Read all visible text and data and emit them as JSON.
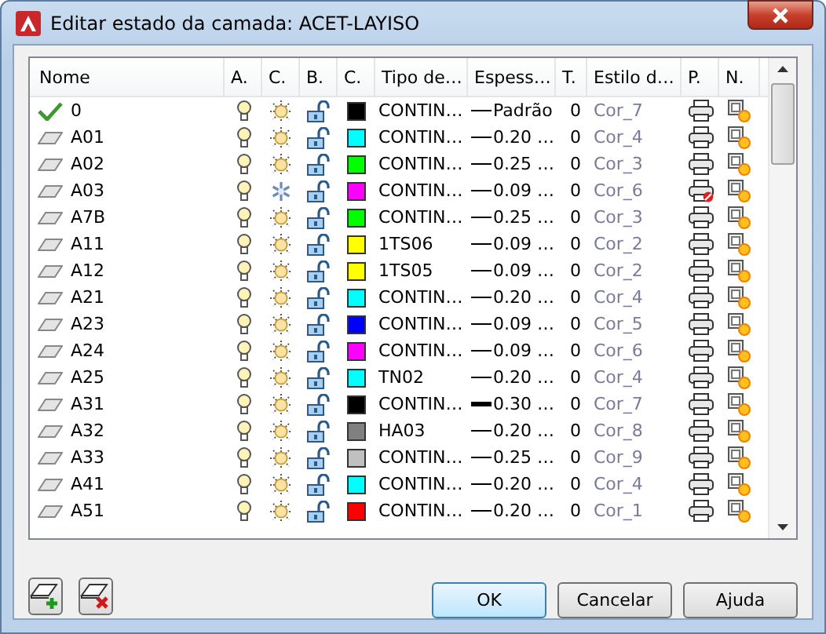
{
  "window": {
    "title": "Editar estado da camada: ACET-LAYISO"
  },
  "columns": [
    "Nome",
    "A.",
    "C.",
    "B.",
    "C.",
    "Tipo de…",
    "Espess…",
    "T.",
    "Estilo d…",
    "P.",
    "N."
  ],
  "rows": [
    {
      "name": "0",
      "current": true,
      "on": true,
      "frozen": false,
      "locked": false,
      "color": "#000000",
      "linetype": "CONTIN…",
      "lineweight": "Padrão",
      "heavy": false,
      "transparency": "0",
      "plot_style": "Cor_7",
      "plot": true
    },
    {
      "name": "A01",
      "current": false,
      "on": true,
      "frozen": false,
      "locked": false,
      "color": "#00ffff",
      "linetype": "CONTIN…",
      "lineweight": "0.20 …",
      "heavy": false,
      "transparency": "0",
      "plot_style": "Cor_4",
      "plot": true
    },
    {
      "name": "A02",
      "current": false,
      "on": true,
      "frozen": false,
      "locked": false,
      "color": "#00ff00",
      "linetype": "CONTIN…",
      "lineweight": "0.25 …",
      "heavy": false,
      "transparency": "0",
      "plot_style": "Cor_3",
      "plot": true
    },
    {
      "name": "A03",
      "current": false,
      "on": true,
      "frozen": true,
      "locked": false,
      "color": "#ff00ff",
      "linetype": "CONTIN…",
      "lineweight": "0.09 …",
      "heavy": false,
      "transparency": "0",
      "plot_style": "Cor_6",
      "plot": false
    },
    {
      "name": "A7B",
      "current": false,
      "on": true,
      "frozen": false,
      "locked": false,
      "color": "#00ff00",
      "linetype": "CONTIN…",
      "lineweight": "0.25 …",
      "heavy": false,
      "transparency": "0",
      "plot_style": "Cor_3",
      "plot": true
    },
    {
      "name": "A11",
      "current": false,
      "on": true,
      "frozen": false,
      "locked": false,
      "color": "#ffff00",
      "linetype": "1TS06",
      "lineweight": "0.09 …",
      "heavy": false,
      "transparency": "0",
      "plot_style": "Cor_2",
      "plot": true
    },
    {
      "name": "A12",
      "current": false,
      "on": true,
      "frozen": false,
      "locked": false,
      "color": "#ffff00",
      "linetype": "1TS05",
      "lineweight": "0.09 …",
      "heavy": false,
      "transparency": "0",
      "plot_style": "Cor_2",
      "plot": true
    },
    {
      "name": "A21",
      "current": false,
      "on": true,
      "frozen": false,
      "locked": false,
      "color": "#00ffff",
      "linetype": "CONTIN…",
      "lineweight": "0.20 …",
      "heavy": false,
      "transparency": "0",
      "plot_style": "Cor_4",
      "plot": true
    },
    {
      "name": "A23",
      "current": false,
      "on": true,
      "frozen": false,
      "locked": false,
      "color": "#0000ff",
      "linetype": "CONTIN…",
      "lineweight": "0.09 …",
      "heavy": false,
      "transparency": "0",
      "plot_style": "Cor_5",
      "plot": true
    },
    {
      "name": "A24",
      "current": false,
      "on": true,
      "frozen": false,
      "locked": false,
      "color": "#ff00ff",
      "linetype": "CONTIN…",
      "lineweight": "0.09 …",
      "heavy": false,
      "transparency": "0",
      "plot_style": "Cor_6",
      "plot": true
    },
    {
      "name": "A25",
      "current": false,
      "on": true,
      "frozen": false,
      "locked": false,
      "color": "#00ffff",
      "linetype": "TN02",
      "lineweight": "0.20 …",
      "heavy": false,
      "transparency": "0",
      "plot_style": "Cor_4",
      "plot": true
    },
    {
      "name": "A31",
      "current": false,
      "on": true,
      "frozen": false,
      "locked": false,
      "color": "#000000",
      "linetype": "CONTIN…",
      "lineweight": "0.30 …",
      "heavy": true,
      "transparency": "0",
      "plot_style": "Cor_7",
      "plot": true
    },
    {
      "name": "A32",
      "current": false,
      "on": true,
      "frozen": false,
      "locked": false,
      "color": "#808080",
      "linetype": "HA03",
      "lineweight": "0.20 …",
      "heavy": false,
      "transparency": "0",
      "plot_style": "Cor_8",
      "plot": true
    },
    {
      "name": "A33",
      "current": false,
      "on": true,
      "frozen": false,
      "locked": false,
      "color": "#c0c0c0",
      "linetype": "CONTIN…",
      "lineweight": "0.25 …",
      "heavy": false,
      "transparency": "0",
      "plot_style": "Cor_9",
      "plot": true
    },
    {
      "name": "A41",
      "current": false,
      "on": true,
      "frozen": false,
      "locked": false,
      "color": "#00ffff",
      "linetype": "CONTIN…",
      "lineweight": "0.20 …",
      "heavy": false,
      "transparency": "0",
      "plot_style": "Cor_4",
      "plot": true
    },
    {
      "name": "A51",
      "current": false,
      "on": true,
      "frozen": false,
      "locked": false,
      "color": "#ff0000",
      "linetype": "CONTIN…",
      "lineweight": "0.20 …",
      "heavy": false,
      "transparency": "0",
      "plot_style": "Cor_1",
      "plot": true
    }
  ],
  "buttons": [
    "OK",
    "Cancelar",
    "Ajuda"
  ]
}
